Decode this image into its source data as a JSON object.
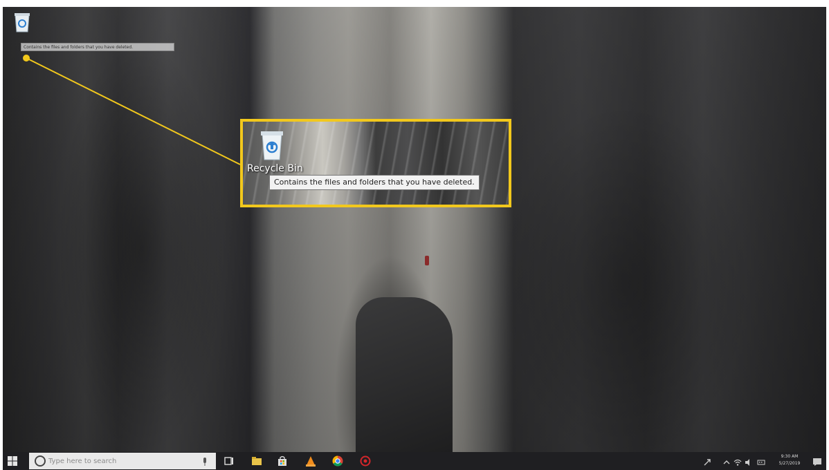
{
  "desktop": {
    "recycle_bin_label": "Recycle Bin",
    "recycle_bin_icon": "recycle-bin-icon",
    "tooltip_small": "Contains the files and folders that you have deleted.",
    "tooltip_zoom": "Contains the files and folders that you have deleted.",
    "highlight_color": "#f2c81c"
  },
  "taskbar": {
    "search_placeholder": "Type here to search",
    "pinned_apps": [
      "task-view-icon",
      "file-explorer-icon",
      "store-icon",
      "vlc-icon",
      "chrome-icon",
      "app-red-icon"
    ],
    "clock_time": "9:30 AM",
    "clock_date": "5/27/2019"
  }
}
